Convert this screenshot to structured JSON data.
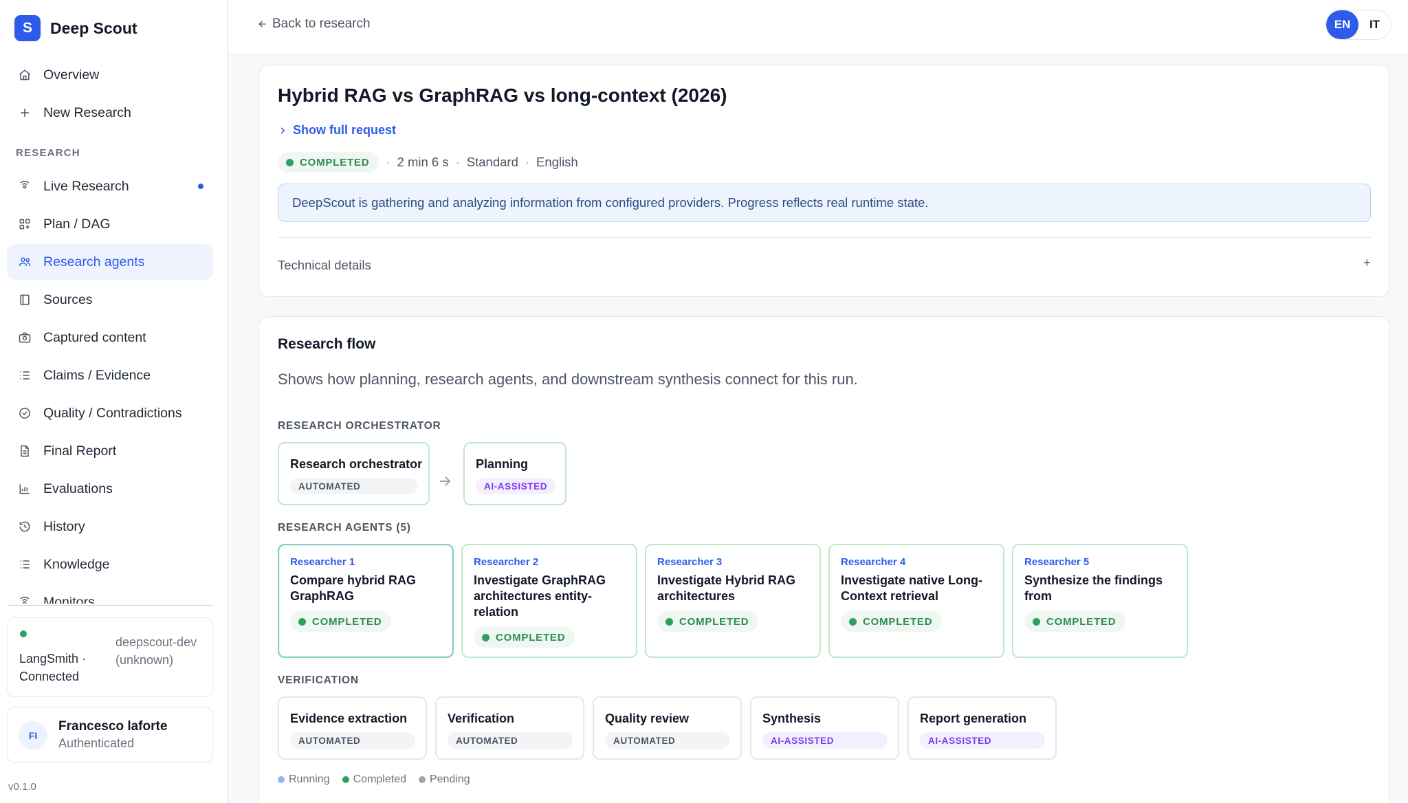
{
  "app": {
    "logo_letter": "S",
    "name": "Deep Scout"
  },
  "sidebar": {
    "top_items": [
      {
        "label": "Overview",
        "icon": "home-icon"
      },
      {
        "label": "New Research",
        "icon": "plus-icon"
      }
    ],
    "section_label": "RESEARCH",
    "items": [
      {
        "label": "Live Research",
        "icon": "broadcast-icon",
        "has_dot": true
      },
      {
        "label": "Plan / DAG",
        "icon": "grid-icon"
      },
      {
        "label": "Research agents",
        "icon": "users-icon",
        "active": true
      },
      {
        "label": "Sources",
        "icon": "book-icon"
      },
      {
        "label": "Captured content",
        "icon": "camera-icon"
      },
      {
        "label": "Claims / Evidence",
        "icon": "list-icon"
      },
      {
        "label": "Quality / Contradictions",
        "icon": "check-circle-icon"
      },
      {
        "label": "Final Report",
        "icon": "document-icon"
      },
      {
        "label": "Evaluations",
        "icon": "bar-chart-icon"
      },
      {
        "label": "History",
        "icon": "history-icon"
      },
      {
        "label": "Knowledge",
        "icon": "list-icon"
      },
      {
        "label": "Monitors",
        "icon": "broadcast-icon"
      }
    ],
    "langsmith": {
      "status": "LangSmith · Connected",
      "env": "deepscout-dev (unknown)"
    },
    "user": {
      "initials": "FI",
      "name": "Francesco laforte",
      "status": "Authenticated"
    },
    "version": "v0.1.0"
  },
  "topbar": {
    "back_label": "Back to research",
    "lang": {
      "active": "EN",
      "other": "IT"
    }
  },
  "research": {
    "title": "Hybrid RAG vs GraphRAG vs long-context (2026)",
    "show_request": "Show full request",
    "status": "COMPLETED",
    "duration": "2 min 6 s",
    "depth": "Standard",
    "language": "English",
    "info": "DeepScout is gathering and analyzing information from configured providers. Progress reflects real runtime state.",
    "technical_details": "Technical details",
    "expand_symbol": "+"
  },
  "flow": {
    "title": "Research flow",
    "description": "Shows how planning, research agents, and downstream synthesis connect for this run.",
    "orchestrator_label": "RESEARCH ORCHESTRATOR",
    "orchestrator_nodes": [
      {
        "title": "Research orchestrator",
        "tag": "AUTOMATED"
      },
      {
        "title": "Planning",
        "tag": "AI-ASSISTED"
      }
    ],
    "agents_label": "RESEARCH AGENTS (5)",
    "agents": [
      {
        "kicker": "Researcher 1",
        "title": "Compare hybrid RAG GraphRAG",
        "status": "COMPLETED"
      },
      {
        "kicker": "Researcher 2",
        "title": "Investigate GraphRAG architectures entity-relation",
        "status": "COMPLETED"
      },
      {
        "kicker": "Researcher 3",
        "title": "Investigate Hybrid RAG architectures",
        "status": "COMPLETED"
      },
      {
        "kicker": "Researcher 4",
        "title": "Investigate native Long-Context retrieval",
        "status": "COMPLETED"
      },
      {
        "kicker": "Researcher 5",
        "title": "Synthesize the findings from",
        "status": "COMPLETED"
      }
    ],
    "verification_label": "VERIFICATION",
    "verification_nodes": [
      {
        "title": "Evidence extraction",
        "tag": "AUTOMATED"
      },
      {
        "title": "Verification",
        "tag": "AUTOMATED"
      },
      {
        "title": "Quality review",
        "tag": "AUTOMATED"
      },
      {
        "title": "Synthesis",
        "tag": "AI-ASSISTED"
      },
      {
        "title": "Report generation",
        "tag": "AI-ASSISTED"
      }
    ],
    "legend": [
      {
        "label": "Running",
        "color": "#93b4f5"
      },
      {
        "label": "Completed",
        "color": "#2f9e61"
      },
      {
        "label": "Pending",
        "color": "#9ca3af"
      }
    ]
  },
  "colors": {
    "accent": "#2e5bea",
    "success": "#2f9e61",
    "ai": "#7c3aed"
  }
}
